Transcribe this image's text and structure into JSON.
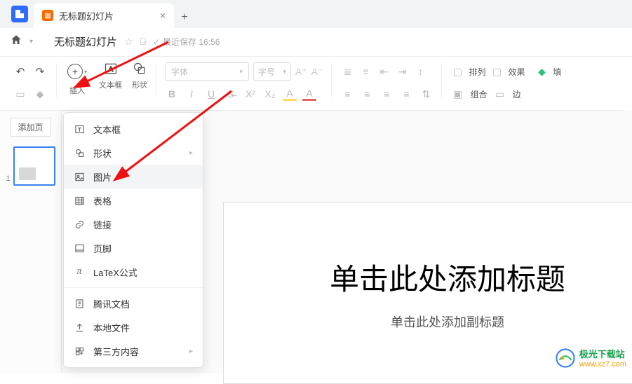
{
  "tab": {
    "title": "无标题幻灯片"
  },
  "titlebar": {
    "doc_title": "无标题幻灯片",
    "save_status": "最近保存 16:56"
  },
  "toolbar": {
    "insert": "插入",
    "textbox": "文本框",
    "shape": "形状",
    "font_placeholder": "字体",
    "fontsize_placeholder": "字号",
    "arrange": "排列",
    "group": "组合",
    "effect": "效果",
    "border": "边",
    "fill": "填"
  },
  "sidebar": {
    "add_page": "添加页",
    "thumb_num": "1"
  },
  "menu": {
    "items": [
      {
        "label": "文本框",
        "icon": "textbox-icon",
        "arrow": false
      },
      {
        "label": "形状",
        "icon": "shape-icon",
        "arrow": true
      },
      {
        "label": "图片",
        "icon": "image-icon",
        "arrow": false
      },
      {
        "label": "表格",
        "icon": "table-icon",
        "arrow": false
      },
      {
        "label": "链接",
        "icon": "link-icon",
        "arrow": false
      },
      {
        "label": "页脚",
        "icon": "footer-icon",
        "arrow": false
      },
      {
        "label": "LaTeX公式",
        "icon": "latex-icon",
        "arrow": false
      }
    ],
    "items2": [
      {
        "label": "腾讯文档",
        "icon": "tencent-doc-icon",
        "arrow": false
      },
      {
        "label": "本地文件",
        "icon": "upload-icon",
        "arrow": false
      },
      {
        "label": "第三方内容",
        "icon": "third-party-icon",
        "arrow": true
      }
    ]
  },
  "slide": {
    "title": "单击此处添加标题",
    "subtitle": "单击此处添加副标题"
  },
  "watermark": {
    "line1": "极光下载站",
    "line2": "www.xz7.com"
  }
}
